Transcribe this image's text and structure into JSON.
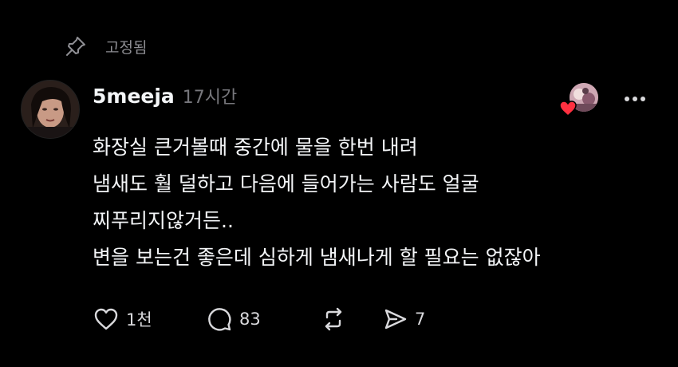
{
  "pinned": {
    "label": "고정됨",
    "icon": "pin-icon"
  },
  "post": {
    "author": "5meeja",
    "time": "17시간",
    "avatar_icon": "user-avatar",
    "liked_by_icon": "liker-avatar",
    "heart_color": "#ff3040",
    "lines": [
      "화장실 큰거볼때 중간에 물을 한번 내려",
      "냄새도 훨 덜하고 다음에 들어가는 사람도 얼굴",
      "찌푸리지않거든..",
      "변을 보는건 좋은데 심하게 냄새나게 할 필요는 없잖아"
    ]
  },
  "actions": {
    "like": {
      "icon": "heart-icon",
      "count": "1천"
    },
    "reply": {
      "icon": "comment-icon",
      "count": "83"
    },
    "repost": {
      "icon": "repost-icon",
      "count": ""
    },
    "share": {
      "icon": "send-icon",
      "count": "7"
    }
  },
  "colors": {
    "background": "#000000",
    "text": "#f3f5f7",
    "muted": "#8e8e93"
  }
}
